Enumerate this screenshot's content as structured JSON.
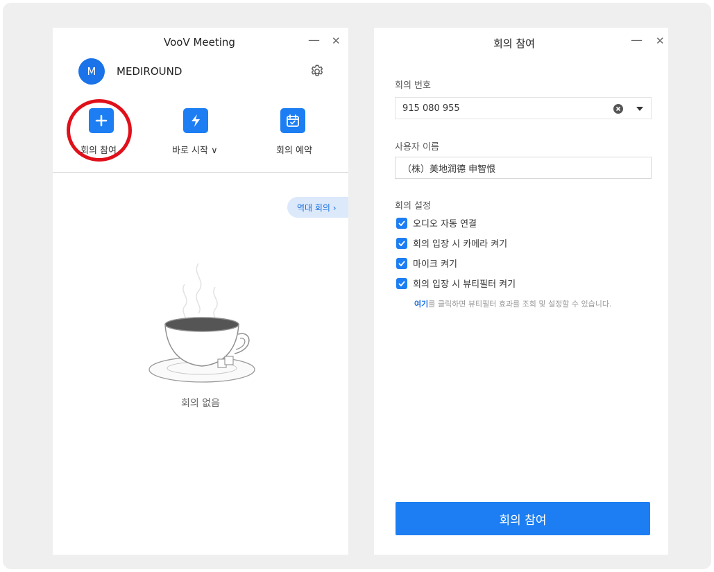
{
  "left_window": {
    "title": "VooV Meeting",
    "minimize": "—",
    "close": "✕",
    "avatar_letter": "M",
    "username": "MEDIROUND",
    "actions": [
      {
        "label": "회의 참여",
        "icon": "plus-icon"
      },
      {
        "label": "바로 시작 ∨",
        "icon": "lightning-icon"
      },
      {
        "label": "회의 예약",
        "icon": "calendar-icon"
      }
    ],
    "history_label": "역대 회의 ›",
    "empty_label": "회의 없음"
  },
  "right_window": {
    "title": "회의 참여",
    "minimize": "—",
    "close": "✕",
    "meeting_number_label": "회의 번호",
    "meeting_number_value": "915  080  955",
    "user_name_label": "사용자 이름",
    "user_name_value": "（株）美地润德 申智恨",
    "settings_label": "회의 설정",
    "options": [
      {
        "label": "오디오 자동 연결",
        "checked": true
      },
      {
        "label": "회의 입장 시 카메라 켜기",
        "checked": true
      },
      {
        "label": "마이크 켜기",
        "checked": true
      },
      {
        "label": "회의 입장 시 뷰티필터 켜기",
        "checked": true
      }
    ],
    "hint_link": "여기",
    "hint_text": "를 클릭하면 뷰티필터 효과를 조회 및 설정할 수 있습니다.",
    "join_button": "회의 참여"
  },
  "colors": {
    "accent": "#1c7ef2",
    "highlight_circle": "#e0101a",
    "backdrop": "#efeff0"
  }
}
